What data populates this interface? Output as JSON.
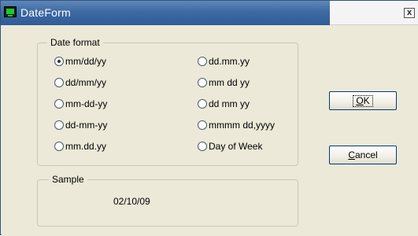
{
  "window": {
    "title": "DateForm",
    "close_glyph": "x"
  },
  "date_format": {
    "group_label": "Date format",
    "options": [
      {
        "label": "mm/dd/yy",
        "checked": true
      },
      {
        "label": "dd.mm.yy",
        "checked": false
      },
      {
        "label": "dd/mm/yy",
        "checked": false
      },
      {
        "label": "mm dd yy",
        "checked": false
      },
      {
        "label": "mm-dd-yy",
        "checked": false
      },
      {
        "label": "dd mm yy",
        "checked": false
      },
      {
        "label": "dd-mm-yy",
        "checked": false
      },
      {
        "label": "mmmm dd,yyyy",
        "checked": false
      },
      {
        "label": "mm.dd.yy",
        "checked": false
      },
      {
        "label": "Day of Week",
        "checked": false
      }
    ]
  },
  "sample": {
    "group_label": "Sample",
    "value": "02/10/09"
  },
  "buttons": {
    "ok": {
      "mnemonic": "O",
      "rest": "K"
    },
    "cancel": {
      "mnemonic": "C",
      "rest": "ancel"
    }
  },
  "colors": {
    "titlebar": "#3e6aa3",
    "dialog_bg": "#ece9d8",
    "button_border": "#003c74"
  }
}
